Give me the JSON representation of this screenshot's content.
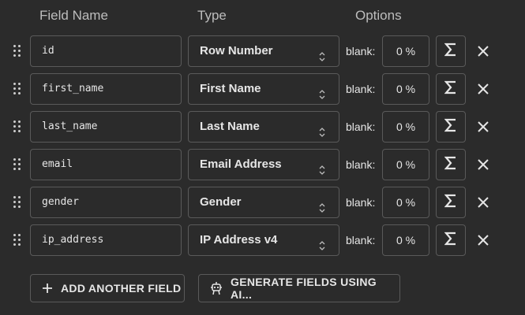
{
  "headers": {
    "field_name": "Field Name",
    "type": "Type",
    "options": "Options"
  },
  "rows": [
    {
      "name": "id",
      "type": "Row Number",
      "blank_label": "blank:",
      "blank_value": "0 %"
    },
    {
      "name": "first_name",
      "type": "First Name",
      "blank_label": "blank:",
      "blank_value": "0 %"
    },
    {
      "name": "last_name",
      "type": "Last Name",
      "blank_label": "blank:",
      "blank_value": "0 %"
    },
    {
      "name": "email",
      "type": "Email Address",
      "blank_label": "blank:",
      "blank_value": "0 %"
    },
    {
      "name": "gender",
      "type": "Gender",
      "blank_label": "blank:",
      "blank_value": "0 %"
    },
    {
      "name": "ip_address",
      "type": "IP Address v4",
      "blank_label": "blank:",
      "blank_value": "0 %"
    }
  ],
  "buttons": {
    "add_field": "ADD ANOTHER FIELD",
    "generate_ai": "GENERATE FIELDS USING AI..."
  },
  "icons": {
    "drag": "drag-handle-icon",
    "select": "updown-chevron-icon",
    "formula": "sigma-icon",
    "remove": "close-icon",
    "add": "plus-icon",
    "ai": "robot-icon"
  },
  "colors": {
    "background": "#2b2b2b",
    "border": "#5a5a5a",
    "text": "#e6e6e6",
    "header": "#bdbdbd"
  }
}
